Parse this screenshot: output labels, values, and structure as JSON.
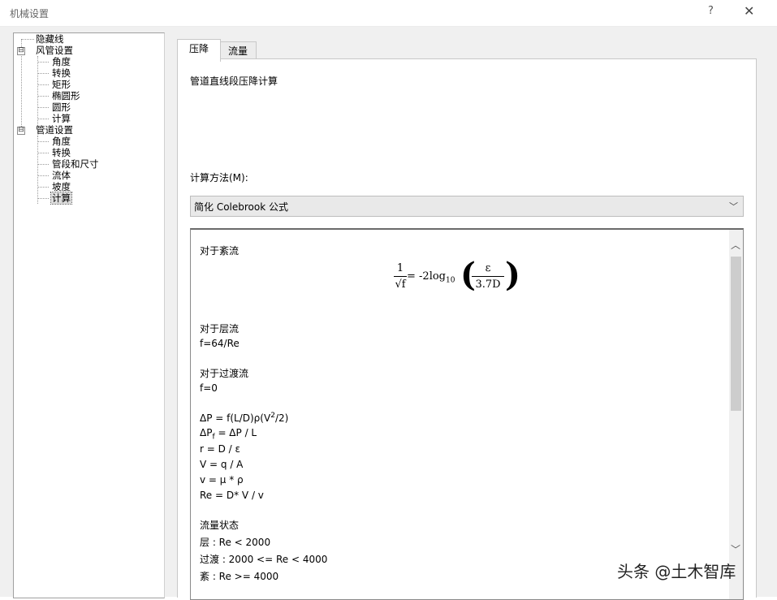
{
  "window": {
    "title": "机械设置",
    "help": "?",
    "close": "✕"
  },
  "tree": {
    "items": [
      {
        "label": "隐藏线"
      },
      {
        "label": "风管设置",
        "expander": "⊟"
      },
      {
        "label": "角度"
      },
      {
        "label": "转换"
      },
      {
        "label": "矩形"
      },
      {
        "label": "椭圆形"
      },
      {
        "label": "圆形"
      },
      {
        "label": "计算"
      },
      {
        "label": "管道设置",
        "expander": "⊟"
      },
      {
        "label": "角度"
      },
      {
        "label": "转换"
      },
      {
        "label": "管段和尺寸"
      },
      {
        "label": "流体"
      },
      {
        "label": "坡度"
      },
      {
        "label": "计算"
      }
    ]
  },
  "tabs": [
    {
      "label": "压降"
    },
    {
      "label": "流量"
    }
  ],
  "panel": {
    "heading": "管道直线段压降计算",
    "method_label": "计算方法(M):",
    "method_value": "简化 Colebrook 公式"
  },
  "formulas": {
    "turbulent_label": "对于紊流",
    "eq_num": "1",
    "eq_den": "√f",
    "eq_mid": "= -2log",
    "eq_sub": "10",
    "eq_paren_l": "(",
    "eq_paren_r": ")",
    "eq_frac_num": "ε",
    "eq_frac_den": "3.7D",
    "laminar_label": "对于层流",
    "laminar_eq": "f=64/Re",
    "transition_label": "对于过渡流",
    "transition_eq": "f=0",
    "dp_a": "ΔP = f(L/D)ρ(V",
    "dp_sup": "2",
    "dp_b": "/2)",
    "dpf_a": "ΔP",
    "dpf_sub": "f",
    "dpf_b": " = ΔP / L",
    "r_eq": "r = D / ε",
    "v_eq": "V = q / A",
    "nu_eq": "v = μ * ρ",
    "re_eq": "Re = D* V / v",
    "flow_state_label": "流量状态",
    "state_laminar": "层 : Re < 2000",
    "state_transition": "过渡 : 2000 <= Re < 4000",
    "state_turbulent": "紊 : Re >= 4000"
  },
  "scrollbar": {
    "up": "︿",
    "down": "﹀"
  },
  "watermark": "头条 @土木智库"
}
